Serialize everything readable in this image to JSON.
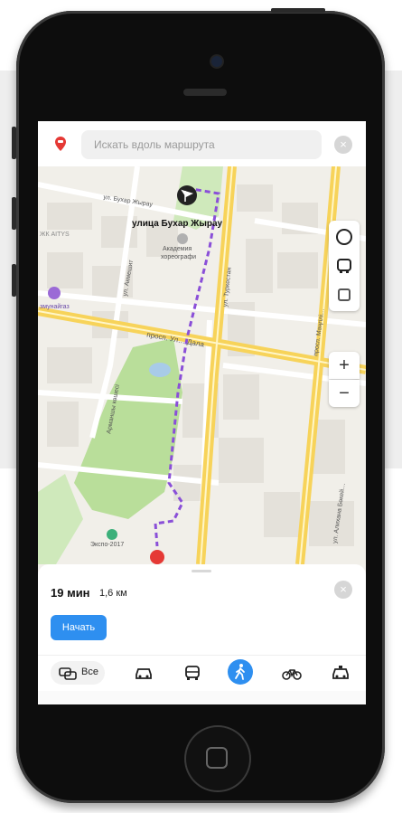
{
  "search": {
    "placeholder": "Искать вдоль маршрута",
    "close": "×"
  },
  "map": {
    "labels": {
      "street_buhar": "ул. Бухар Жырау",
      "destination": "улица Бухар Жырау",
      "academy_line1": "Академия",
      "academy_line2": "хореографи",
      "aitys": "ЖК AITYS",
      "gas": "змунайгаз",
      "street_akmeshit": "ул. Акмешит",
      "street_turkestan": "ул. Туркестан",
      "prospect_dala": "просп. Ул… Дала",
      "prospect_mangilik": "просп. Мәңгілі…",
      "street_aktash": "ул. Алихана Бөкей…",
      "armanshy": "Арманшы көшесі",
      "expo": "Экспо-2017",
      "cross": "сс-\nр"
    },
    "zoom_in": "+",
    "zoom_out": "−"
  },
  "route": {
    "time": "19 мин",
    "distance": "1,6 км",
    "close": "×",
    "start_button": "Начать"
  },
  "modes": {
    "all_label": "Все",
    "items": [
      "car-icon",
      "bus-icon",
      "walk-icon",
      "bike-icon",
      "taxi-icon"
    ],
    "active": "walk-icon"
  },
  "colors": {
    "accent": "#2e8ff0",
    "route": "#8a4fd8",
    "road_major": "#f7d35a",
    "park": "#b9de9a",
    "pin": "#e53935"
  }
}
